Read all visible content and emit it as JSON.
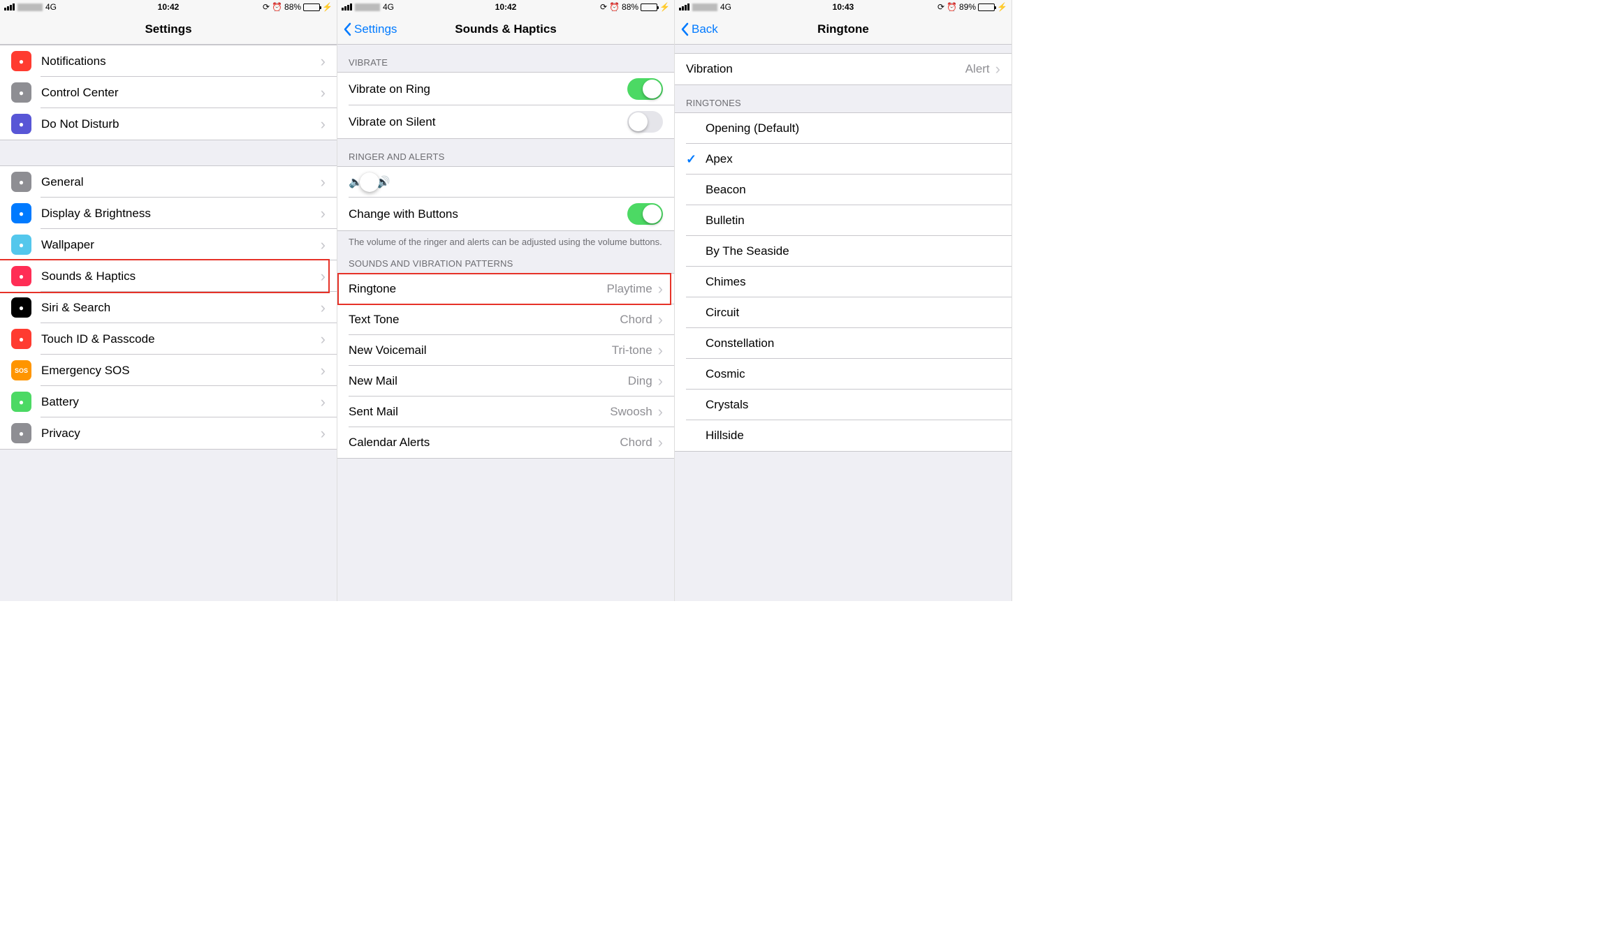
{
  "screen1": {
    "status": {
      "network": "4G",
      "time": "10:42",
      "battery": "88%"
    },
    "title": "Settings",
    "group1": [
      {
        "label": "Notifications",
        "icon_color": "ic-red"
      },
      {
        "label": "Control Center",
        "icon_color": "ic-gray"
      },
      {
        "label": "Do Not Disturb",
        "icon_color": "ic-purple"
      }
    ],
    "group2": [
      {
        "label": "General",
        "icon_color": "ic-gray"
      },
      {
        "label": "Display & Brightness",
        "icon_color": "ic-blue"
      },
      {
        "label": "Wallpaper",
        "icon_color": "ic-cyan"
      },
      {
        "label": "Sounds & Haptics",
        "icon_color": "ic-pink",
        "highlighted": true
      },
      {
        "label": "Siri & Search",
        "icon_color": "ic-black"
      },
      {
        "label": "Touch ID & Passcode",
        "icon_color": "ic-red"
      },
      {
        "label": "Emergency SOS",
        "icon_color": "ic-orange",
        "icon_text": "SOS"
      },
      {
        "label": "Battery",
        "icon_color": "ic-green"
      },
      {
        "label": "Privacy",
        "icon_color": "ic-gray"
      }
    ]
  },
  "screen2": {
    "status": {
      "network": "4G",
      "time": "10:42",
      "battery": "88%"
    },
    "back": "Settings",
    "title": "Sounds & Haptics",
    "vibrate_header": "VIBRATE",
    "vibrate": [
      {
        "label": "Vibrate on Ring",
        "on": true
      },
      {
        "label": "Vibrate on Silent",
        "on": false
      }
    ],
    "ringer_header": "RINGER AND ALERTS",
    "change_buttons": {
      "label": "Change with Buttons",
      "on": true
    },
    "ringer_footer": "The volume of the ringer and alerts can be adjusted using the volume buttons.",
    "sounds_header": "SOUNDS AND VIBRATION PATTERNS",
    "sounds": [
      {
        "label": "Ringtone",
        "value": "Playtime",
        "highlighted": true
      },
      {
        "label": "Text Tone",
        "value": "Chord"
      },
      {
        "label": "New Voicemail",
        "value": "Tri-tone"
      },
      {
        "label": "New Mail",
        "value": "Ding"
      },
      {
        "label": "Sent Mail",
        "value": "Swoosh"
      },
      {
        "label": "Calendar Alerts",
        "value": "Chord"
      }
    ]
  },
  "screen3": {
    "status": {
      "network": "4G",
      "time": "10:43",
      "battery": "89%"
    },
    "back": "Back",
    "title": "Ringtone",
    "vibration": {
      "label": "Vibration",
      "value": "Alert"
    },
    "ringtones_header": "RINGTONES",
    "ringtones": [
      {
        "label": "Opening (Default)",
        "selected": false
      },
      {
        "label": "Apex",
        "selected": true
      },
      {
        "label": "Beacon",
        "selected": false
      },
      {
        "label": "Bulletin",
        "selected": false
      },
      {
        "label": "By The Seaside",
        "selected": false
      },
      {
        "label": "Chimes",
        "selected": false
      },
      {
        "label": "Circuit",
        "selected": false
      },
      {
        "label": "Constellation",
        "selected": false
      },
      {
        "label": "Cosmic",
        "selected": false
      },
      {
        "label": "Crystals",
        "selected": false
      },
      {
        "label": "Hillside",
        "selected": false
      }
    ]
  }
}
